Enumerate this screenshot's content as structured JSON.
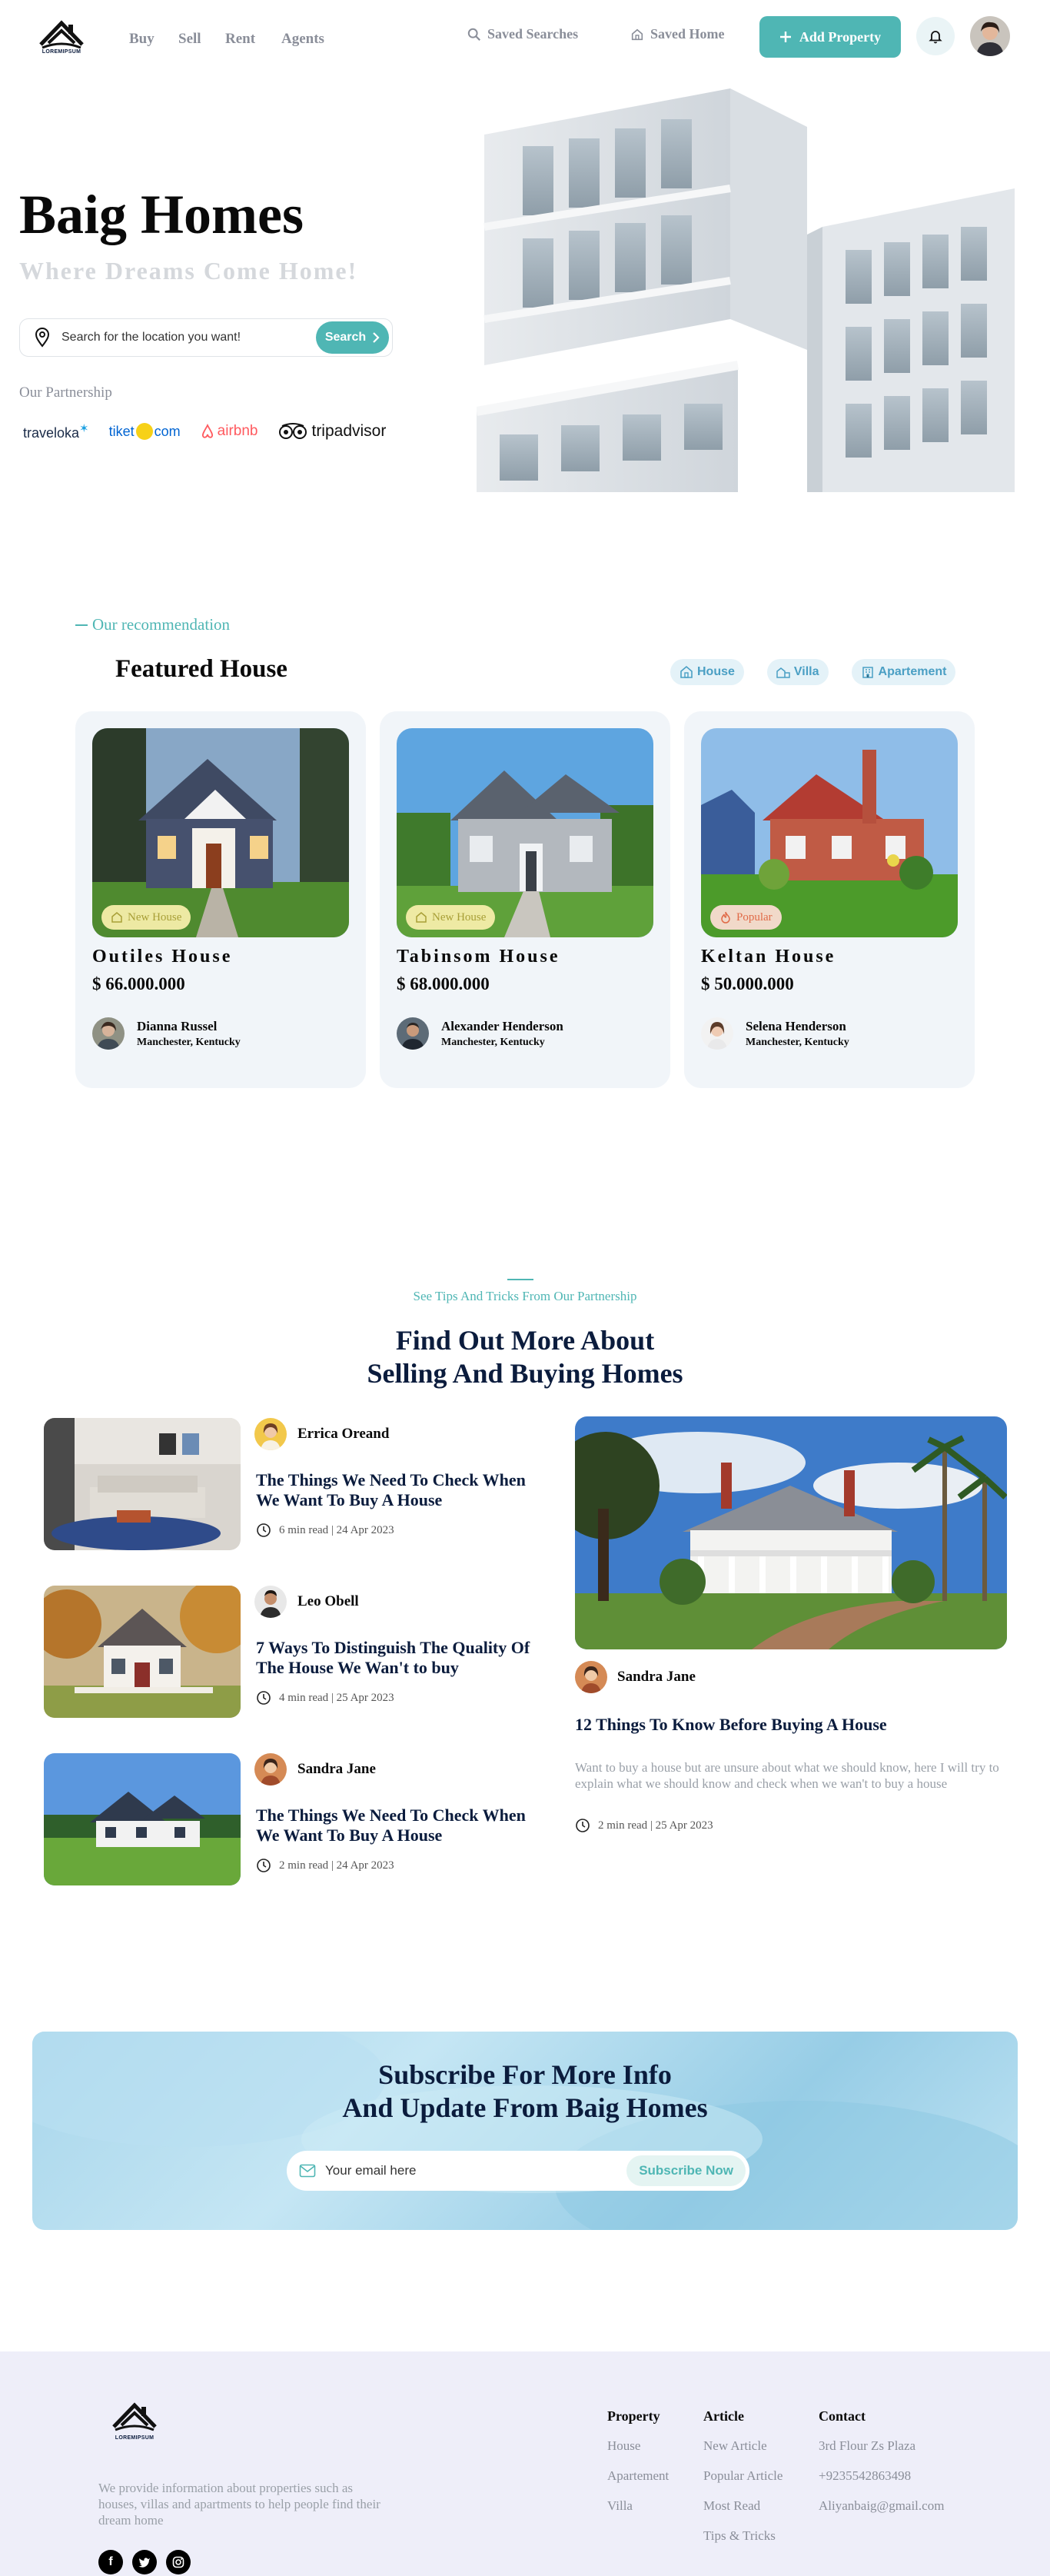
{
  "header": {
    "logo_text": "LOREMIPSUM",
    "nav": [
      "Buy",
      "Sell",
      "Rent",
      "Agents"
    ],
    "saved_searches": "Saved Searches",
    "saved_home": "Saved Home",
    "add_property": "Add Property"
  },
  "hero": {
    "title": "Baig Homes",
    "subtitle": "Where Dreams Come Home!",
    "search_placeholder": "Search for the location you want!",
    "search_button": "Search",
    "partnership_label": "Our Partnership",
    "partners": [
      "traveloka",
      "tiket",
      "com",
      "airbnb",
      "tripadvisor"
    ]
  },
  "featured": {
    "eyebrow": "Our recommendation",
    "title": "Featured House",
    "chips": [
      "House",
      "Villa",
      "Apartement"
    ],
    "cards": [
      {
        "name": "Outiles House",
        "price": "$ 66.000.000",
        "badge": "New House",
        "agent": "Dianna Russel",
        "location": "Manchester, Kentucky"
      },
      {
        "name": "Tabinsom House",
        "price": "$ 68.000.000",
        "badge": "New House",
        "agent": "Alexander Henderson",
        "location": "Manchester, Kentucky"
      },
      {
        "name": "Keltan House",
        "price": "$ 50.000.000",
        "badge": "Popular",
        "agent": "Selena Henderson",
        "location": "Manchester, Kentucky"
      }
    ]
  },
  "articles": {
    "eyebrow": "See Tips And Tricks From Our Partnership",
    "title_line1": "Find Out More About",
    "title_line2": "Selling And Buying Homes",
    "list": [
      {
        "author": "Errica Oreand",
        "title": "The Things We Need To Check When We Want To Buy A House",
        "meta": "6 min read | 24 Apr 2023"
      },
      {
        "author": "Leo Obell",
        "title": "7 Ways To Distinguish The Quality Of The House We Wan't to buy",
        "meta": "4 min read | 25 Apr 2023"
      },
      {
        "author": "Sandra Jane",
        "title": "The Things We Need To Check When We Want To Buy A House",
        "meta": "2 min read | 24 Apr 2023"
      }
    ],
    "featured": {
      "author": "Sandra Jane",
      "title": "12 Things To Know Before Buying A House",
      "desc": "Want to buy a house but are unsure about what we should know, here I will try to explain what we should know and check when we wan't to buy a house",
      "meta": "2 min read | 25 Apr 2023"
    }
  },
  "subscribe": {
    "title_line1": "Subscribe For More Info",
    "title_line2": "And Update From Baig Homes",
    "placeholder": "Your email here",
    "button": "Subscribe Now"
  },
  "footer": {
    "logo_text": "LOREMIPSUM",
    "description": "We provide information about properties such as houses, villas and apartments to help people find their dream home",
    "columns": [
      {
        "title": "Property",
        "items": [
          "House",
          "Apartement",
          "Villa"
        ]
      },
      {
        "title": "Article",
        "items": [
          "New Article",
          "Popular Article",
          "Most Read",
          "Tips & Tricks"
        ]
      },
      {
        "title": "Contact",
        "items": [
          "3rd Flour Zs Plaza",
          "+9235542863498",
          "Aliyanbaig@gmail.com"
        ]
      }
    ],
    "socials": [
      "f",
      "t",
      "ig"
    ]
  },
  "colors": {
    "accent": "#4fb6b4",
    "navy": "#0b1c3d",
    "muted": "#8a8e99",
    "card_bg": "#f1f5f9",
    "footer_bg": "#eeeef9"
  }
}
